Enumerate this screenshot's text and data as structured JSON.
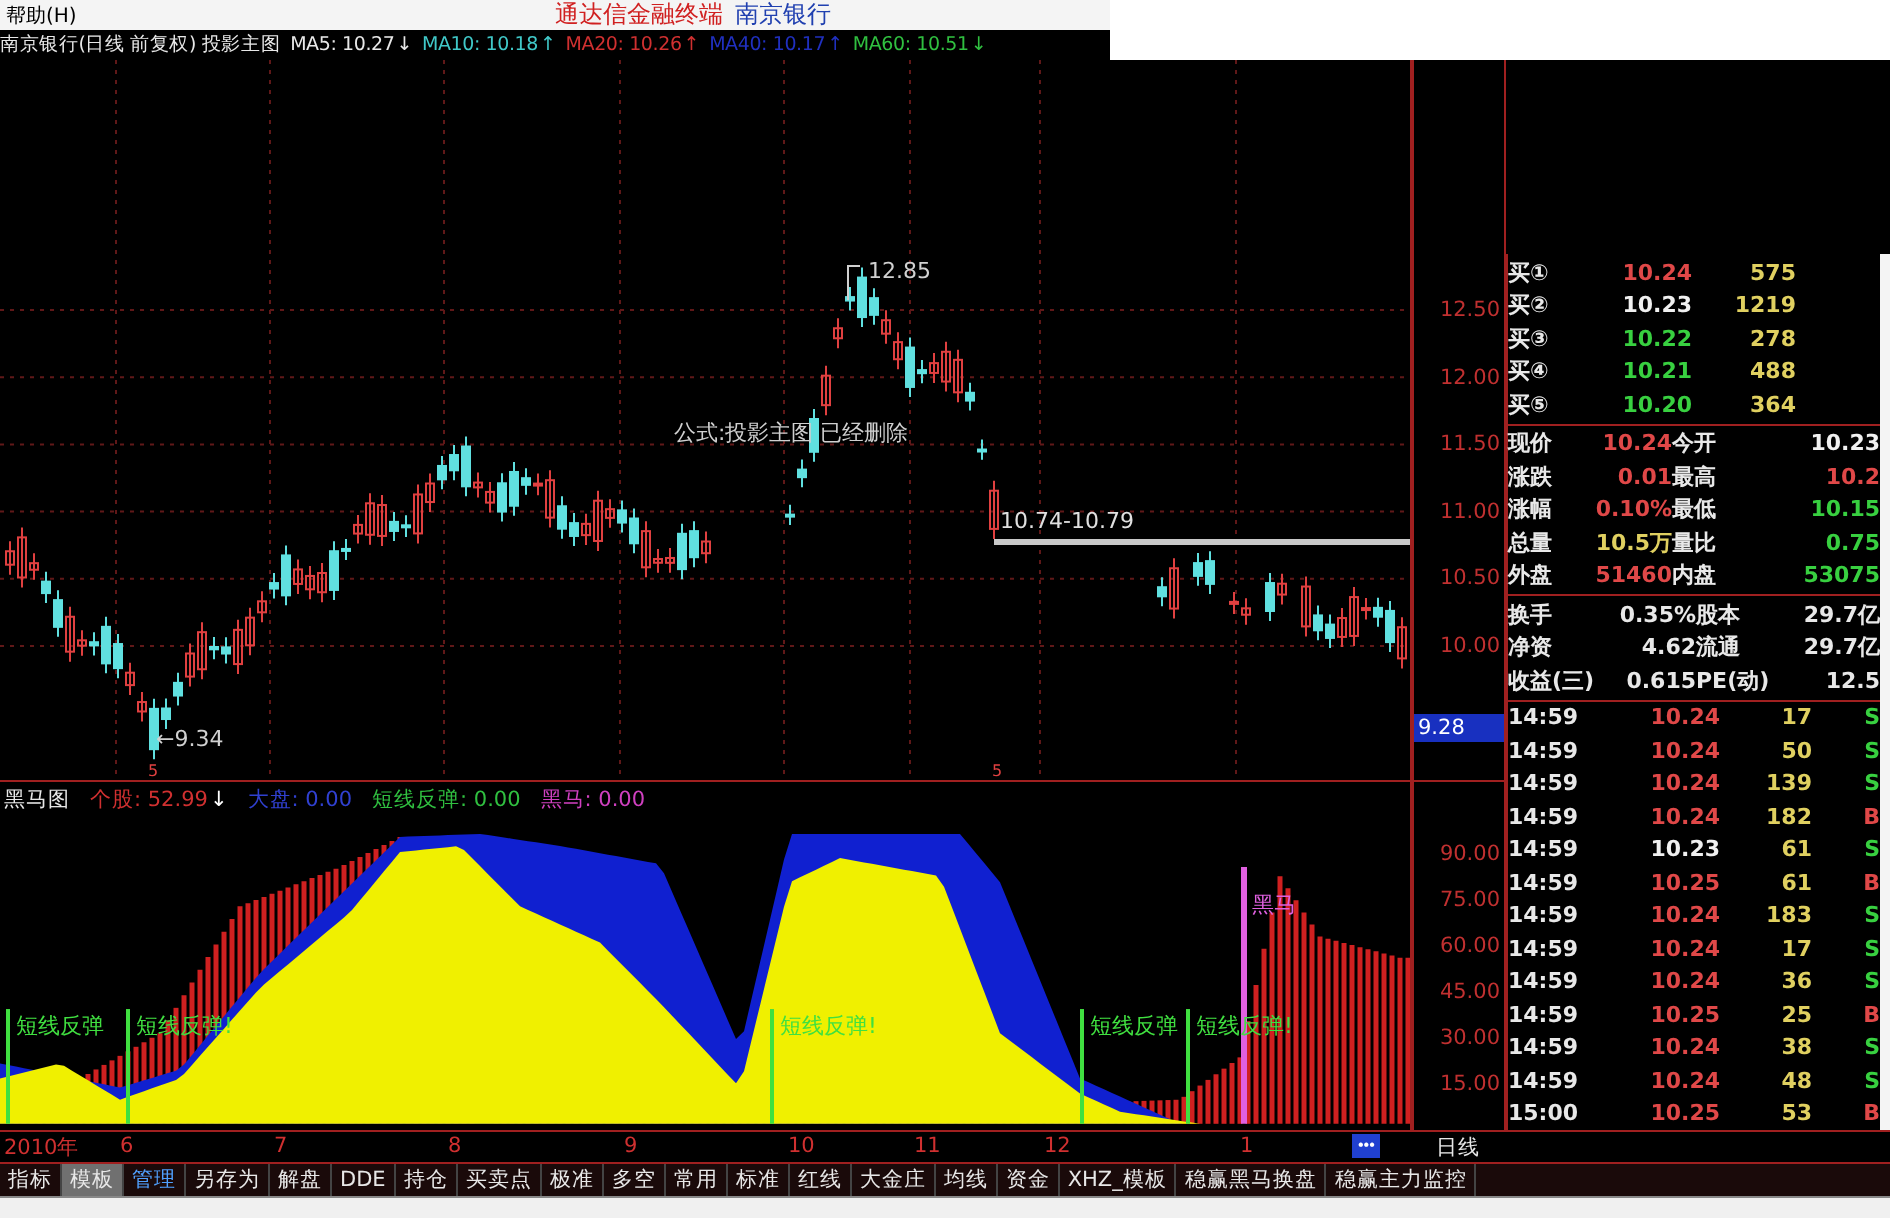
{
  "menu": {
    "item": "帮助(H)",
    "app_name": "通达信金融终端",
    "stock_name": "南京银行"
  },
  "chart_header": {
    "title": "南京银行(日线 前复权) 投影主图",
    "averages": [
      {
        "label": "MA5: 10.27",
        "arrow": "↓",
        "color": "#e8e8e8"
      },
      {
        "label": "MA10: 10.18",
        "arrow": "↑",
        "color": "#40c8c8"
      },
      {
        "label": "MA20: 10.26",
        "arrow": "↑",
        "color": "#d03030"
      },
      {
        "label": "MA40: 10.17",
        "arrow": "↑",
        "color": "#2030c0"
      },
      {
        "label": "MA60: 10.51",
        "arrow": "↓",
        "color": "#30c040"
      }
    ]
  },
  "main_chart": {
    "high_label": "12.85",
    "low_label": "←9.34",
    "range_label": "10.74-10.79",
    "notice": "公式:投影主图 已经删除",
    "markers": [
      "5",
      "5"
    ]
  },
  "price_axis": {
    "ticks": [
      "12.50",
      "12.00",
      "11.50",
      "11.00",
      "10.50",
      "10.00"
    ],
    "current": "9.28"
  },
  "quote": {
    "bids": [
      {
        "label": "买①",
        "price": "10.24",
        "color": "#e04848",
        "volume": "575"
      },
      {
        "label": "买②",
        "price": "10.23",
        "color": "#f0f0f0",
        "volume": "1219"
      },
      {
        "label": "买③",
        "price": "10.22",
        "color": "#38d040",
        "volume": "278"
      },
      {
        "label": "买④",
        "price": "10.21",
        "color": "#38d040",
        "volume": "488"
      },
      {
        "label": "买⑤",
        "price": "10.20",
        "color": "#38d040",
        "volume": "364"
      }
    ],
    "stats": [
      {
        "items": [
          {
            "label": "现价",
            "value": "10.24",
            "color": "#e04848"
          },
          {
            "label": "今开",
            "value": "10.23",
            "color": "#f0f0f0"
          }
        ]
      },
      {
        "items": [
          {
            "label": "涨跌",
            "value": "0.01",
            "color": "#e04848"
          },
          {
            "label": "最高",
            "value": "10.2",
            "color": "#e04848"
          }
        ]
      },
      {
        "items": [
          {
            "label": "涨幅",
            "value": "0.10%",
            "color": "#e04848"
          },
          {
            "label": "最低",
            "value": "10.15",
            "color": "#38d040"
          }
        ]
      },
      {
        "items": [
          {
            "label": "总量",
            "value": "10.5万",
            "color": "#e0d060"
          },
          {
            "label": "量比",
            "value": "0.75",
            "color": "#38d040"
          }
        ]
      },
      {
        "items": [
          {
            "label": "外盘",
            "value": "51460",
            "color": "#e04848"
          },
          {
            "label": "内盘",
            "value": "53075",
            "color": "#38d040"
          }
        ]
      }
    ],
    "finance": [
      {
        "label": "换手",
        "value": "0.35%",
        "label_2": "股本",
        "value_2": "29.7亿"
      },
      {
        "label": "净资",
        "value": "4.62",
        "label_2": "流通",
        "value_2": "29.7亿"
      },
      {
        "label": "收益(三)",
        "value": "0.615",
        "label_2": "PE(动)",
        "value_2": "12.5"
      }
    ],
    "ticks": [
      {
        "time": "14:59",
        "price": "10.24",
        "color": "#e04848",
        "volume": "17",
        "side": {
          "text": "S",
          "color": "#38d040"
        }
      },
      {
        "time": "14:59",
        "price": "10.24",
        "color": "#e04848",
        "volume": "50",
        "side": {
          "text": "S",
          "color": "#38d040"
        }
      },
      {
        "time": "14:59",
        "price": "10.24",
        "color": "#e04848",
        "volume": "139",
        "side": {
          "text": "S",
          "color": "#38d040"
        }
      },
      {
        "time": "14:59",
        "price": "10.24",
        "color": "#e04848",
        "volume": "182",
        "side": {
          "text": "B",
          "color": "#e04848"
        }
      },
      {
        "time": "14:59",
        "price": "10.23",
        "color": "#f0f0f0",
        "volume": "61",
        "side": {
          "text": "S",
          "color": "#38d040"
        }
      },
      {
        "time": "14:59",
        "price": "10.25",
        "color": "#e04848",
        "volume": "61",
        "side": {
          "text": "B",
          "color": "#e04848"
        }
      },
      {
        "time": "14:59",
        "price": "10.24",
        "color": "#e04848",
        "volume": "183",
        "side": {
          "text": "S",
          "color": "#38d040"
        }
      },
      {
        "time": "14:59",
        "price": "10.24",
        "color": "#e04848",
        "volume": "17",
        "side": {
          "text": "S",
          "color": "#38d040"
        }
      },
      {
        "time": "14:59",
        "price": "10.24",
        "color": "#e04848",
        "volume": "36",
        "side": {
          "text": "S",
          "color": "#38d040"
        }
      },
      {
        "time": "14:59",
        "price": "10.25",
        "color": "#e04848",
        "volume": "25",
        "side": {
          "text": "B",
          "color": "#e04848"
        }
      },
      {
        "time": "14:59",
        "price": "10.24",
        "color": "#e04848",
        "volume": "38",
        "side": {
          "text": "S",
          "color": "#38d040"
        }
      },
      {
        "time": "14:59",
        "price": "10.24",
        "color": "#e04848",
        "volume": "48",
        "side": {
          "text": "S",
          "color": "#38d040"
        }
      },
      {
        "time": "15:00",
        "price": "10.25",
        "color": "#e04848",
        "volume": "53",
        "side": {
          "text": "B",
          "color": "#e04848"
        }
      }
    ]
  },
  "indicator": {
    "name": "黑马图",
    "values": [
      {
        "label": "个股: 52.99",
        "arrow": "↓",
        "color": "#d03030"
      },
      {
        "label": "大盘: 0.00",
        "color": "#3040d0"
      },
      {
        "label": "短线反弹: 0.00",
        "color": "#30c040"
      },
      {
        "label": "黑马: 0.00",
        "color": "#d040c0"
      }
    ],
    "signals": [
      "短线反弹",
      "短线反弹!",
      "短线反弹!",
      "短线反弹",
      "短线反弹!"
    ],
    "horse_label": "黑马",
    "axis": [
      "90.00",
      "75.00",
      "60.00",
      "45.00",
      "30.00",
      "15.00"
    ]
  },
  "date_axis": {
    "year": "2010年",
    "months": [
      "6",
      "7",
      "8",
      "9",
      "10",
      "11",
      "12",
      "1"
    ],
    "more": "•••",
    "period": "日线"
  },
  "tabs": [
    {
      "label": "指标",
      "kind": "tab",
      "selected": false
    },
    {
      "label": "模板",
      "kind": "tab",
      "selected": true
    },
    {
      "label": "管理",
      "kind": "link",
      "selected": false
    },
    {
      "label": "另存为",
      "kind": "tab",
      "selected": false
    },
    {
      "label": "解盘",
      "kind": "tab",
      "selected": false
    },
    {
      "label": "DDE",
      "kind": "tab",
      "selected": false
    },
    {
      "label": "持仓",
      "kind": "tab",
      "selected": false
    },
    {
      "label": "买卖点",
      "kind": "tab",
      "selected": false
    },
    {
      "label": "极准",
      "kind": "tab",
      "selected": false
    },
    {
      "label": "多空",
      "kind": "tab",
      "selected": false
    },
    {
      "label": "常用",
      "kind": "tab",
      "selected": false
    },
    {
      "label": "标准",
      "kind": "tab",
      "selected": false
    },
    {
      "label": "红线",
      "kind": "tab",
      "selected": false
    },
    {
      "label": "大金庄",
      "kind": "tab",
      "selected": false
    },
    {
      "label": "均线",
      "kind": "tab",
      "selected": false
    },
    {
      "label": "资金",
      "kind": "tab",
      "selected": false
    },
    {
      "label": "XHZ_模板",
      "kind": "tab",
      "selected": false
    },
    {
      "label": "稳赢黑马换盘",
      "kind": "tab",
      "selected": false
    },
    {
      "label": "稳赢主力监控",
      "kind": "tab",
      "selected": false
    }
  ]
}
